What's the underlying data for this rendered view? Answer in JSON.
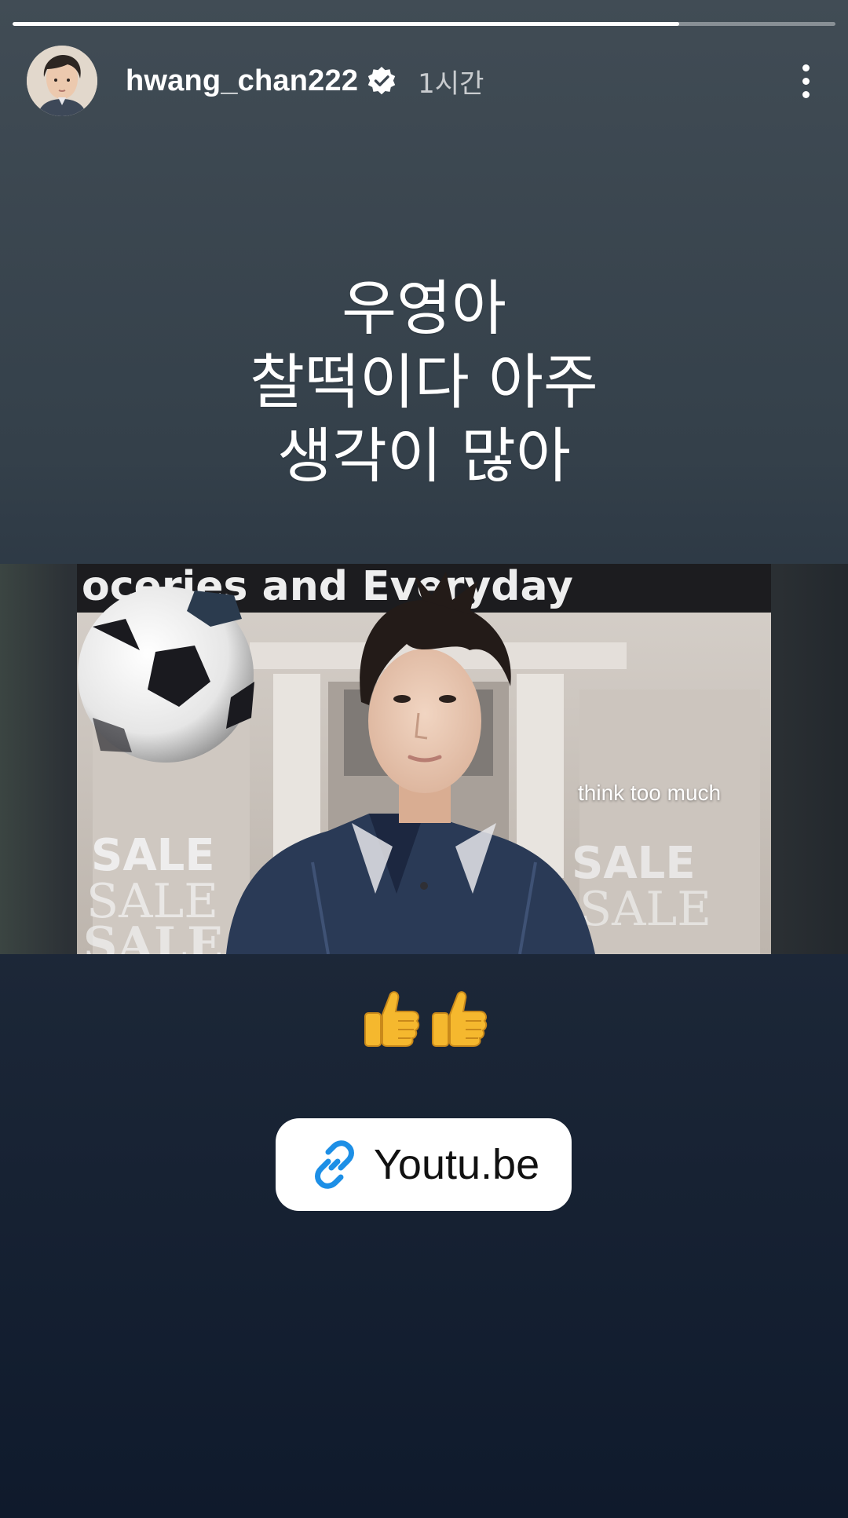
{
  "story": {
    "progress": 0.81,
    "progress_color": "#ffffff",
    "background_top": "#414c55",
    "background_bottom": "#0f1a2c"
  },
  "header": {
    "username": "hwang_chan222",
    "verified": true,
    "time": "1시간",
    "avatar_icon": "profile-photo",
    "more_icon": "more-vertical-icon"
  },
  "caption": {
    "lines": [
      "우영아",
      "찰떡이다 아주",
      "생각이 많아"
    ]
  },
  "media": {
    "overlay_text": "think too much",
    "sign_text": "oceries and Everyday",
    "sale_text": "SALE"
  },
  "emoji": {
    "items": [
      "thumbs-up-emoji",
      "thumbs-up-emoji"
    ]
  },
  "link": {
    "label": "Youtu.be",
    "icon": "link-icon",
    "icon_color": "#1d8fe6"
  }
}
